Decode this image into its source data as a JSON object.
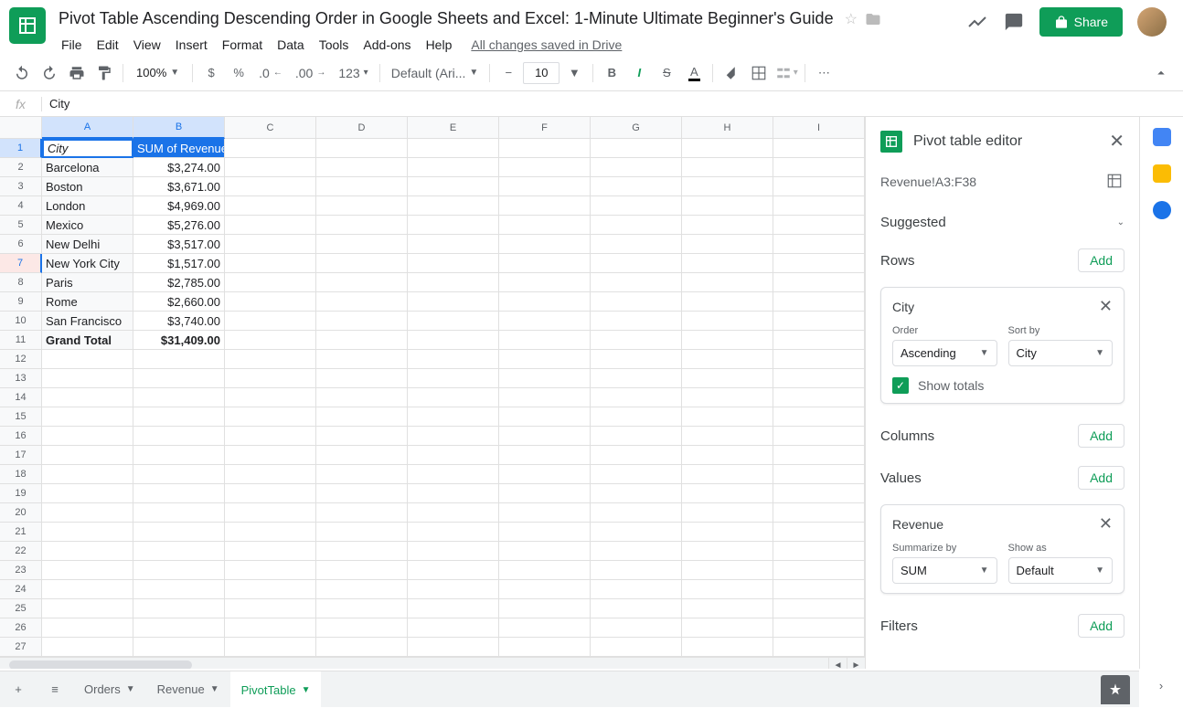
{
  "doc_title": "Pivot Table Ascending Descending Order in Google Sheets and Excel: 1-Minute Ultimate Beginner's Guide",
  "menubar": [
    "File",
    "Edit",
    "View",
    "Insert",
    "Format",
    "Data",
    "Tools",
    "Add-ons",
    "Help"
  ],
  "save_state": "All changes saved in Drive",
  "share_label": "Share",
  "toolbar": {
    "zoom": "100%",
    "currency": "$",
    "percent": "%",
    "dec_dec": ".0",
    "inc_dec": ".00",
    "more_fmt": "123",
    "font": "Default (Ari...",
    "font_size": "10"
  },
  "formula_bar": {
    "fx": "fx",
    "value": "City"
  },
  "columns": [
    "A",
    "B",
    "C",
    "D",
    "E",
    "F",
    "G",
    "H",
    "I"
  ],
  "rows": [
    {
      "n": 1,
      "a": "City",
      "b": "SUM of Revenue",
      "hdr": true
    },
    {
      "n": 2,
      "a": "Barcelona",
      "b": "$3,274.00"
    },
    {
      "n": 3,
      "a": "Boston",
      "b": "$3,671.00"
    },
    {
      "n": 4,
      "a": "London",
      "b": "$4,969.00"
    },
    {
      "n": 5,
      "a": "Mexico",
      "b": "$5,276.00"
    },
    {
      "n": 6,
      "a": "New Delhi",
      "b": "$3,517.00"
    },
    {
      "n": 7,
      "a": "New York City",
      "b": "$1,517.00"
    },
    {
      "n": 8,
      "a": "Paris",
      "b": "$2,785.00"
    },
    {
      "n": 9,
      "a": "Rome",
      "b": "$2,660.00"
    },
    {
      "n": 10,
      "a": "San Francisco",
      "b": "$3,740.00"
    },
    {
      "n": 11,
      "a": "Grand Total",
      "b": "$31,409.00",
      "bold": true
    }
  ],
  "empty_rows": [
    12,
    13,
    14,
    15,
    16,
    17,
    18,
    19,
    20,
    21,
    22,
    23,
    24,
    25,
    26,
    27
  ],
  "pivot_editor": {
    "title": "Pivot table editor",
    "range": "Revenue!A3:F38",
    "suggested": "Suggested",
    "rows_label": "Rows",
    "columns_label": "Columns",
    "values_label": "Values",
    "filters_label": "Filters",
    "add_label": "Add",
    "row_card": {
      "title": "City",
      "order_label": "Order",
      "order_value": "Ascending",
      "sortby_label": "Sort by",
      "sortby_value": "City",
      "show_totals": "Show totals"
    },
    "value_card": {
      "title": "Revenue",
      "summarize_label": "Summarize by",
      "summarize_value": "SUM",
      "showas_label": "Show as",
      "showas_value": "Default"
    }
  },
  "tabs": [
    {
      "name": "Orders",
      "active": false
    },
    {
      "name": "Revenue",
      "active": false
    },
    {
      "name": "PivotTable",
      "active": true
    }
  ]
}
